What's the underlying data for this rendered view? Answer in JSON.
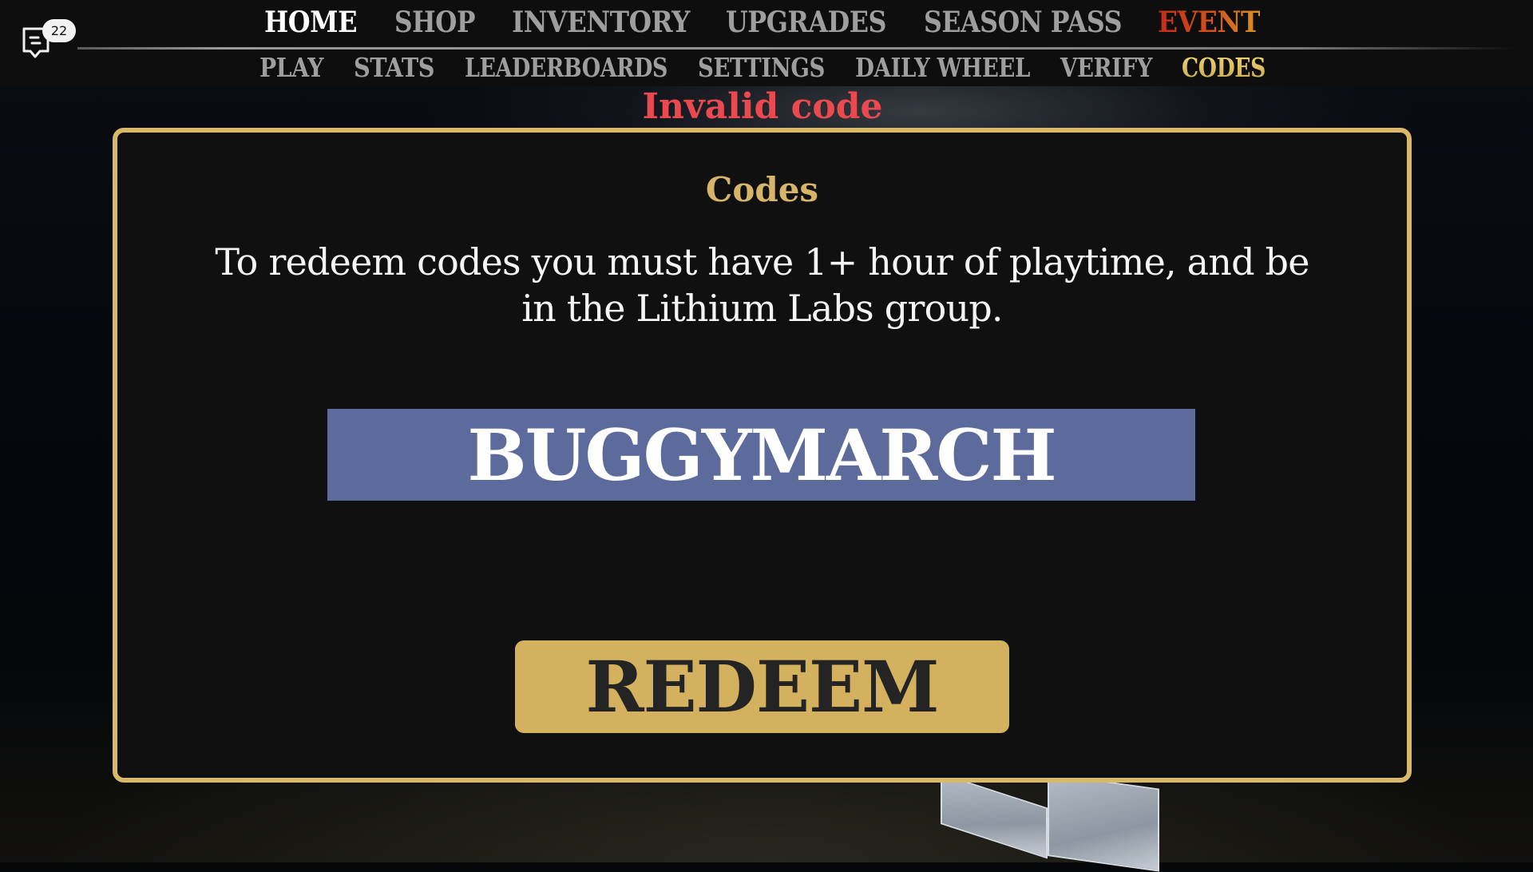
{
  "chat": {
    "icon": "chat-bubble-icon",
    "unread_count": "22"
  },
  "nav": {
    "primary": [
      {
        "label": "HOME",
        "state": "active"
      },
      {
        "label": "SHOP",
        "state": "normal"
      },
      {
        "label": "INVENTORY",
        "state": "normal"
      },
      {
        "label": "UPGRADES",
        "state": "normal"
      },
      {
        "label": "SEASON PASS",
        "state": "normal"
      },
      {
        "label": "EVENT",
        "state": "highlight"
      }
    ],
    "secondary": [
      {
        "label": "PLAY",
        "state": "normal"
      },
      {
        "label": "STATS",
        "state": "normal"
      },
      {
        "label": "LEADERBOARDS",
        "state": "normal"
      },
      {
        "label": "SETTINGS",
        "state": "normal"
      },
      {
        "label": "DAILY WHEEL",
        "state": "normal"
      },
      {
        "label": "VERIFY",
        "state": "normal"
      },
      {
        "label": "CODES",
        "state": "active"
      }
    ]
  },
  "status": {
    "message": "Invalid code",
    "color": "#ea4a4f"
  },
  "codes_panel": {
    "title": "Codes",
    "description": "To redeem codes you must have 1+ hour of playtime, and be in the Lithium Labs group.",
    "code_input_value": "BUGGYMARCH",
    "redeem_label": "REDEEM"
  },
  "colors": {
    "accent_gold": "#d9b86a",
    "input_bg": "#5c6a9c",
    "button_bg": "#d3b15e",
    "event_gradient_start": "#c42c18",
    "event_gradient_end": "#dc8f20",
    "nav_inactive": "#9e9e9e",
    "nav_active": "#ffffff",
    "nav_sub_active": "#e3c566"
  }
}
